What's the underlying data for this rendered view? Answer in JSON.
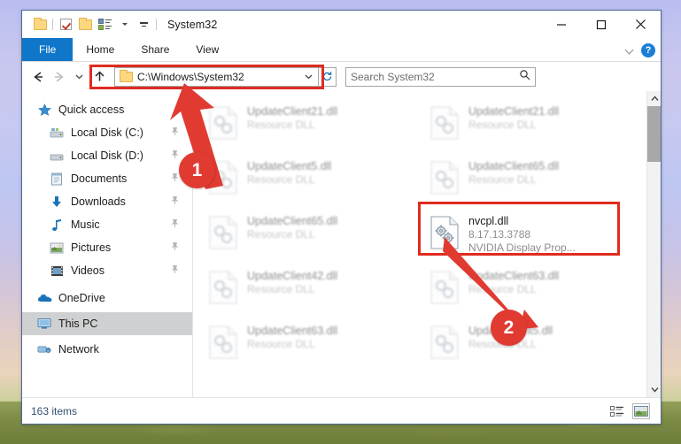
{
  "window": {
    "title": "System32",
    "quick_access_icons": [
      "folder-icon",
      "checkbox-properties-icon",
      "folder-new-icon",
      "properties-icon",
      "customize-toolbar-icon"
    ],
    "controls": {
      "minimize": "minimize-icon",
      "maximize": "maximize-icon",
      "close": "close-icon"
    }
  },
  "ribbon": {
    "tabs": [
      {
        "label": "File",
        "active": true
      },
      {
        "label": "Home",
        "active": false
      },
      {
        "label": "Share",
        "active": false
      },
      {
        "label": "View",
        "active": false
      }
    ],
    "collapse_icon": "chevron-down-icon",
    "help_label": "?"
  },
  "navbar": {
    "back_icon": "arrow-left-icon",
    "forward_icon": "arrow-right-icon",
    "recent_icon": "chevron-down-icon",
    "up_icon": "arrow-up-icon",
    "address_value": "C:\\Windows\\System32",
    "address_dropdown_icon": "chevron-down-icon",
    "refresh_icon": "refresh-icon",
    "search_placeholder": "Search System32",
    "search_icon": "search-icon"
  },
  "sidebar": {
    "items": [
      {
        "label": "Quick access",
        "icon": "star-icon",
        "pinned": false,
        "selected": false,
        "group": true
      },
      {
        "label": "Local Disk (C:)",
        "icon": "drive-icon",
        "pinned": true,
        "selected": false,
        "group": false
      },
      {
        "label": "Local Disk (D:)",
        "icon": "drive-icon",
        "pinned": true,
        "selected": false,
        "group": false
      },
      {
        "label": "Documents",
        "icon": "documents-icon",
        "pinned": true,
        "selected": false,
        "group": false
      },
      {
        "label": "Downloads",
        "icon": "downloads-icon",
        "pinned": true,
        "selected": false,
        "group": false
      },
      {
        "label": "Music",
        "icon": "music-icon",
        "pinned": true,
        "selected": false,
        "group": false
      },
      {
        "label": "Pictures",
        "icon": "pictures-icon",
        "pinned": true,
        "selected": false,
        "group": false
      },
      {
        "label": "Videos",
        "icon": "videos-icon",
        "pinned": true,
        "selected": false,
        "group": false
      },
      {
        "label": "OneDrive",
        "icon": "onedrive-icon",
        "pinned": false,
        "selected": false,
        "group": true
      },
      {
        "label": "This PC",
        "icon": "this-pc-icon",
        "pinned": false,
        "selected": true,
        "group": true
      },
      {
        "label": "Network",
        "icon": "network-icon",
        "pinned": false,
        "selected": false,
        "group": true
      }
    ]
  },
  "files": [
    {
      "name": "UpdateClient21.dll",
      "line2": "Resource DLL",
      "line3": "",
      "icon": "dll-icon",
      "faded": true,
      "selected": false
    },
    {
      "name": "UpdateClient21.dll",
      "line2": "Resource DLL",
      "line3": "",
      "icon": "dll-icon",
      "faded": true,
      "selected": false
    },
    {
      "name": "UpdateClient5.dll",
      "line2": "Resource DLL",
      "line3": "",
      "icon": "dll-icon",
      "faded": true,
      "selected": false
    },
    {
      "name": "UpdateClient65.dll",
      "line2": "Resource DLL",
      "line3": "",
      "icon": "dll-icon",
      "faded": true,
      "selected": false
    },
    {
      "name": "UpdateClient65.dll",
      "line2": "Resource DLL",
      "line3": "",
      "icon": "dll-icon",
      "faded": true,
      "selected": false
    },
    {
      "name": "nvcpl.dll",
      "line2": "8.17.13.3788",
      "line3": "NVIDIA Display Prop...",
      "icon": "gears-dll-icon",
      "faded": false,
      "selected": true
    },
    {
      "name": "UpdateClient42.dll",
      "line2": "Resource DLL",
      "line3": "",
      "icon": "dll-icon",
      "faded": true,
      "selected": false
    },
    {
      "name": "UpdateClient63.dll",
      "line2": "Resource DLL",
      "line3": "",
      "icon": "dll-icon",
      "faded": true,
      "selected": false
    },
    {
      "name": "UpdateClient63.dll",
      "line2": "Resource DLL",
      "line3": "",
      "icon": "dll-icon",
      "faded": true,
      "selected": false
    },
    {
      "name": "UpdateClient5.dll",
      "line2": "Resource DLL",
      "line3": "",
      "icon": "dll-icon",
      "faded": true,
      "selected": false
    }
  ],
  "statusbar": {
    "item_count": "163 items",
    "view_details_icon": "details-view-icon",
    "view_large_icons_icon": "large-icons-view-icon"
  },
  "annotations": {
    "accent_color": "#e02b20",
    "badge_color": "#e03a31",
    "steps": [
      {
        "number": "1",
        "target": "address-bar"
      },
      {
        "number": "2",
        "target": "nvcpl-dll-file"
      }
    ]
  }
}
